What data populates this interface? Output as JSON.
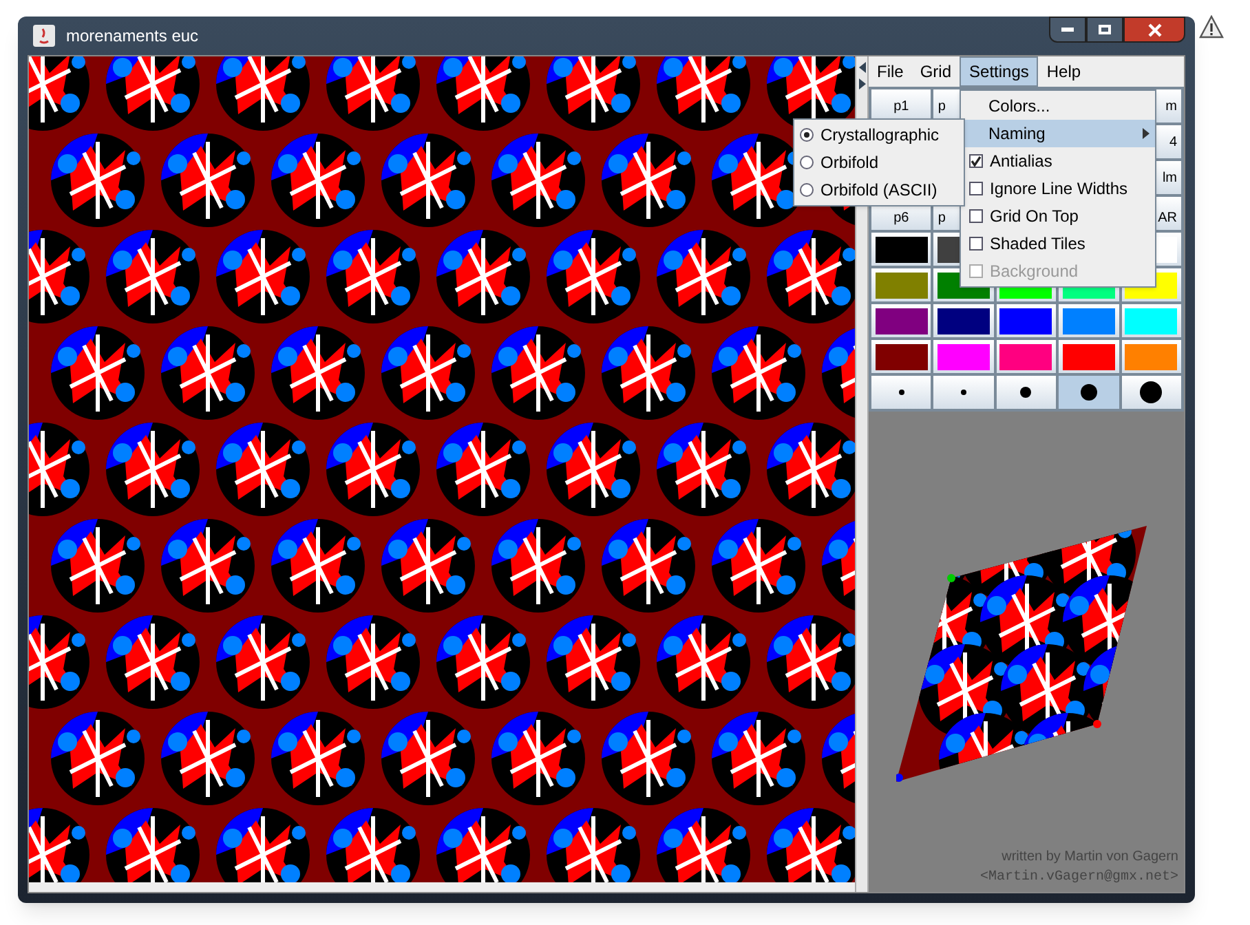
{
  "window": {
    "title": "morenaments euc"
  },
  "menu_bar": [
    {
      "label": "File",
      "selected": false
    },
    {
      "label": "Grid",
      "selected": false
    },
    {
      "label": "Settings",
      "selected": true
    },
    {
      "label": "Help",
      "selected": false
    }
  ],
  "group_buttons": [
    {
      "label": "p1"
    },
    {
      "label": "p"
    },
    {
      "label": "m"
    },
    {
      "label": "4"
    },
    {
      "label": "lm"
    },
    {
      "label": "p6"
    },
    {
      "label": "p"
    },
    {
      "label": "AR"
    }
  ],
  "color_swatches": [
    [
      {
        "color": "#000000"
      },
      {
        "color": "#404040"
      },
      {
        "color": "#ffffff"
      }
    ],
    [
      {
        "color": "#808000"
      },
      {
        "color": "#008000"
      },
      {
        "color": "#00ff00"
      },
      {
        "color": "#00ff80"
      },
      {
        "color": "#ffff00"
      }
    ],
    [
      {
        "color": "#800080"
      },
      {
        "color": "#000080"
      },
      {
        "color": "#0000ff"
      },
      {
        "color": "#0080ff"
      },
      {
        "color": "#00ffff"
      }
    ],
    [
      {
        "color": "#800000"
      },
      {
        "color": "#ff00ff"
      },
      {
        "color": "#ff0080"
      },
      {
        "color": "#ff0000"
      },
      {
        "color": "#ff8000"
      }
    ]
  ],
  "line_widths": [
    {
      "selected": false
    },
    {
      "selected": false
    },
    {
      "selected": false
    },
    {
      "selected": true
    },
    {
      "selected": false
    }
  ],
  "settings_menu": [
    {
      "kind": "item",
      "label": "Colors..."
    },
    {
      "kind": "submenu",
      "label": "Naming",
      "selected": true
    },
    {
      "kind": "check",
      "label": "Antialias",
      "checked": true,
      "disabled": false
    },
    {
      "kind": "check",
      "label": "Ignore Line Widths",
      "checked": false,
      "disabled": false
    },
    {
      "kind": "check",
      "label": "Grid On Top",
      "checked": false,
      "disabled": false
    },
    {
      "kind": "check",
      "label": "Shaded Tiles",
      "checked": false,
      "disabled": false
    },
    {
      "kind": "check",
      "label": "Background",
      "checked": false,
      "disabled": true
    }
  ],
  "naming_submenu": [
    {
      "label": "Crystallographic",
      "selected": true
    },
    {
      "label": "Orbifold",
      "selected": false
    },
    {
      "label": "Orbifold (ASCII)",
      "selected": false
    }
  ],
  "credits": {
    "author": "written by Martin von Gagern",
    "email": "<Martin.vGagern@gmx.net>"
  }
}
